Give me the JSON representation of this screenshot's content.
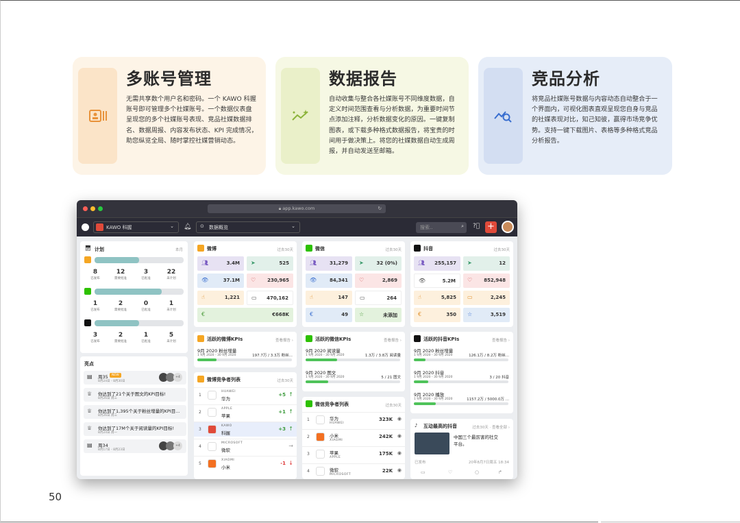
{
  "cards": [
    {
      "title": "多账号管理",
      "text": "无需共享数个用户名和密码。一个 KAWO 科握账号即可管理多个社媒账号。一个数据仪表盘呈现您的多个社媒账号表现、竞品社媒数据排名、数据周报、内容发布状态、KPI 完成情况，助您纵览全局、随时掌控社媒营销动态。",
      "icon": "profile-card-icon",
      "color": "#e8923a"
    },
    {
      "title": "数据报告",
      "text": "自动收集与整合各社媒账号不同维度数据，自定义时间范围查看与分析数据，为重要时间节点添加注释，分析数据变化的原因。一键复制图表，或下载多种格式数据报告，将宝贵的时间用于做决策上。将您的社媒数据自动生成周报，并自动发送至邮箱。",
      "icon": "sparkle-trend-icon",
      "color": "#8cb33a"
    },
    {
      "title": "竞品分析",
      "text": "将竞品社媒账号数据与内容动态自动整合于一个界面内，可视化图表直观呈现您自身与竞品的社媒表现对比，知己知彼，赢得市场竞争优势。支持一键下载图片、表格等多种格式竞品分析报告。",
      "icon": "trend-search-icon",
      "color": "#3a6fd0"
    }
  ],
  "page_number": "50",
  "browser": {
    "url": "app.kawo.com",
    "brand": "KAWO 科握",
    "view": "数据概览",
    "search_placeholder": "搜索..",
    "plan": {
      "title": "计划",
      "period": "本月",
      "rows": [
        {
          "icon": "weibo-icon",
          "fill": 0.5,
          "stats": [
            {
              "n": "8",
              "l": "已发布"
            },
            {
              "n": "12",
              "l": "需要批准"
            },
            {
              "n": "3",
              "l": "已批准"
            },
            {
              "n": "22",
              "l": "未计划"
            }
          ]
        },
        {
          "icon": "wechat-icon",
          "fill": 0.75,
          "stats": [
            {
              "n": "1",
              "l": "已发布"
            },
            {
              "n": "2",
              "l": "需要批准"
            },
            {
              "n": "0",
              "l": "已批准"
            },
            {
              "n": "1",
              "l": "未计划"
            }
          ]
        },
        {
          "icon": "douyin-icon",
          "fill": 0.5,
          "stats": [
            {
              "n": "3",
              "l": "已发布"
            },
            {
              "n": "2",
              "l": "需要批准"
            },
            {
              "n": "1",
              "l": "已批准"
            },
            {
              "n": "5",
              "l": "未计划"
            }
          ]
        }
      ]
    },
    "highlights": {
      "title": "亮点",
      "items": [
        {
          "title": "周35",
          "tag": "NEW",
          "date": "8月24日 - 8月30日",
          "extra": "+4"
        },
        {
          "title": "你达到了21个关于图文的KPI目标!",
          "date": "8月26日 周三"
        },
        {
          "title": "你达到了1,395个关于粉丝增量的KPI目...",
          "date": "8月26日 周三"
        },
        {
          "title": "你达到了17M个关于阅读量的KPI目标!",
          "date": "8月24日 周一"
        },
        {
          "title": "周34",
          "date": "8月17日 - 8月23日",
          "extra": "+4"
        }
      ]
    },
    "weibo": {
      "title": "微博",
      "period": "过去30天",
      "cells": [
        {
          "v": "3.4M",
          "bg": "#e7e2f3",
          "c": "#7a5cc2"
        },
        {
          "v": "525",
          "bg": "#e2f0ea",
          "c": "#3a9a6a"
        },
        {
          "v": "37.1M",
          "bg": "#e1ebf7",
          "c": "#3a6fd0"
        },
        {
          "v": "230,965",
          "bg": "#fbe5e5",
          "c": "#d04848"
        },
        {
          "v": "1,221",
          "bg": "#fdf0dd",
          "c": "#e09230"
        },
        {
          "v": "470,162",
          "bg": "#fff",
          "c": "#555"
        },
        {
          "v": "€668K",
          "bg": "#e3f2dd",
          "c": "#4a9a3a",
          "wide": true
        }
      ]
    },
    "wechat": {
      "title": "微信",
      "period": "过去30天",
      "cells": [
        {
          "v": "31,279",
          "bg": "#e7e2f3",
          "c": "#7a5cc2"
        },
        {
          "v": "32 (0%)",
          "bg": "#e2f0ea",
          "c": "#3a9a6a"
        },
        {
          "v": "84,341",
          "bg": "#e1ebf7",
          "c": "#3a6fd0"
        },
        {
          "v": "2,869",
          "bg": "#fbe5e5",
          "c": "#d04848"
        },
        {
          "v": "147",
          "bg": "#fdf0dd",
          "c": "#e09230"
        },
        {
          "v": "264",
          "bg": "#fff",
          "c": "#555"
        },
        {
          "v": "49",
          "bg": "#e1ebf7",
          "c": "#3a6fd0"
        },
        {
          "v": "未添加",
          "bg": "#e3f2dd",
          "c": "#4a9a3a"
        }
      ]
    },
    "douyin": {
      "title": "抖音",
      "period": "过去30天",
      "cells": [
        {
          "v": "255,157",
          "bg": "#e7e2f3",
          "c": "#7a5cc2"
        },
        {
          "v": "12",
          "bg": "#e2f0ea",
          "c": "#3a9a6a"
        },
        {
          "v": "5.2M",
          "bg": "#fff",
          "c": "#555"
        },
        {
          "v": "852,948",
          "bg": "#fbe5e5",
          "c": "#d04848"
        },
        {
          "v": "5,825",
          "bg": "#fdf0dd",
          "c": "#e09230"
        },
        {
          "v": "2,245",
          "bg": "#fdf0dd",
          "c": "#e09230"
        },
        {
          "v": "350",
          "bg": "#fdf0dd",
          "c": "#e09230"
        },
        {
          "v": "3,519",
          "bg": "#e1ebf7",
          "c": "#3a6fd0"
        }
      ]
    },
    "weibo_kpi": {
      "title": "活跃的微博KPIs",
      "link": "查看报告 ›",
      "items": [
        {
          "name": "9月 2020 粉丝增量",
          "range": "1 9月 2020 - 30 9月 2020",
          "val": "197.7万 / 3.3万 粉丝...",
          "fill": 0.2
        }
      ]
    },
    "wechat_kpi": {
      "title": "活跃的微信KPIs",
      "link": "查看报告 ›",
      "items": [
        {
          "name": "9月 2020 阅读量",
          "range": "1 9月 2020 - 30 9月 2020",
          "val": "1.3万 / 3.8万 阅读量",
          "fill": 0.33
        },
        {
          "name": "9月 2020 图文",
          "range": "1 9月 2020 - 30 9月 2020",
          "val": "5 / 21 图文",
          "fill": 0.24
        }
      ]
    },
    "douyin_kpi": {
      "title": "活跃的抖音KPIs",
      "link": "查看报告 ›",
      "items": [
        {
          "name": "9月 2020 粉丝增量",
          "range": "1 9月 2020 - 30 9月 2020",
          "val": "126.1万 / 8.2万 粉丝...",
          "fill": 0.12
        },
        {
          "name": "9月 2020 抖音",
          "range": "1 9月 2020 - 30 9月 2020",
          "val": "3 / 20 抖音",
          "fill": 0.15
        },
        {
          "name": "9月 2020 播放",
          "range": "1 9月 2020 - 30 9月 2020",
          "val": "1157.2万 / 5000.0万 ...",
          "fill": 0.23
        }
      ]
    },
    "weibo_comp": {
      "title": "微博竞争者列表",
      "period": "过去30天",
      "rows": [
        {
          "rank": "1",
          "en": "HUAWEI",
          "zh": "华为",
          "val": "+5",
          "dir": "↑",
          "color": "#3a9a3a",
          "logo": "#fff",
          "lc": "#d33"
        },
        {
          "rank": "2",
          "en": "APPLE",
          "zh": "苹果",
          "val": "+1",
          "dir": "↑",
          "color": "#3a9a3a",
          "logo": "#fff",
          "lc": "#999"
        },
        {
          "rank": "3",
          "en": "KAWO",
          "zh": "科握",
          "val": "+3",
          "dir": "↑",
          "color": "#3a9a3a",
          "logo": "#e04a3a",
          "lc": "#fff",
          "hl": true
        },
        {
          "rank": "4",
          "en": "MICROSOFT",
          "zh": "微软",
          "val": "",
          "dir": "→",
          "color": "#999",
          "logo": "#fff",
          "lc": "#3a8"
        },
        {
          "rank": "5",
          "en": "XIAOMI",
          "zh": "小米",
          "val": "-1",
          "dir": "↓",
          "color": "#d33",
          "logo": "#f37021",
          "lc": "#fff"
        }
      ]
    },
    "wechat_comp": {
      "title": "微信竞争者列表",
      "period": "过去30天",
      "rows": [
        {
          "rank": "1",
          "zh": "华为",
          "en": "HUAWEI",
          "val": "323K",
          "logo": "#fff"
        },
        {
          "rank": "2",
          "zh": "小米",
          "en": "XIAOMI",
          "val": "242K",
          "logo": "#f37021"
        },
        {
          "rank": "3",
          "zh": "苹果",
          "en": "APPLE",
          "val": "175K",
          "logo": "#fff"
        },
        {
          "rank": "4",
          "zh": "微软",
          "en": "MICROSOFT",
          "val": "22K",
          "logo": "#fff"
        }
      ]
    },
    "douyin_top": {
      "title": "互动最高的抖音",
      "period": "过去30天 · 查看全部 ›",
      "caption": "中国三个最厉害的社交平台。",
      "status": "已发布",
      "date": "20年8月7日周五 18:34"
    }
  }
}
